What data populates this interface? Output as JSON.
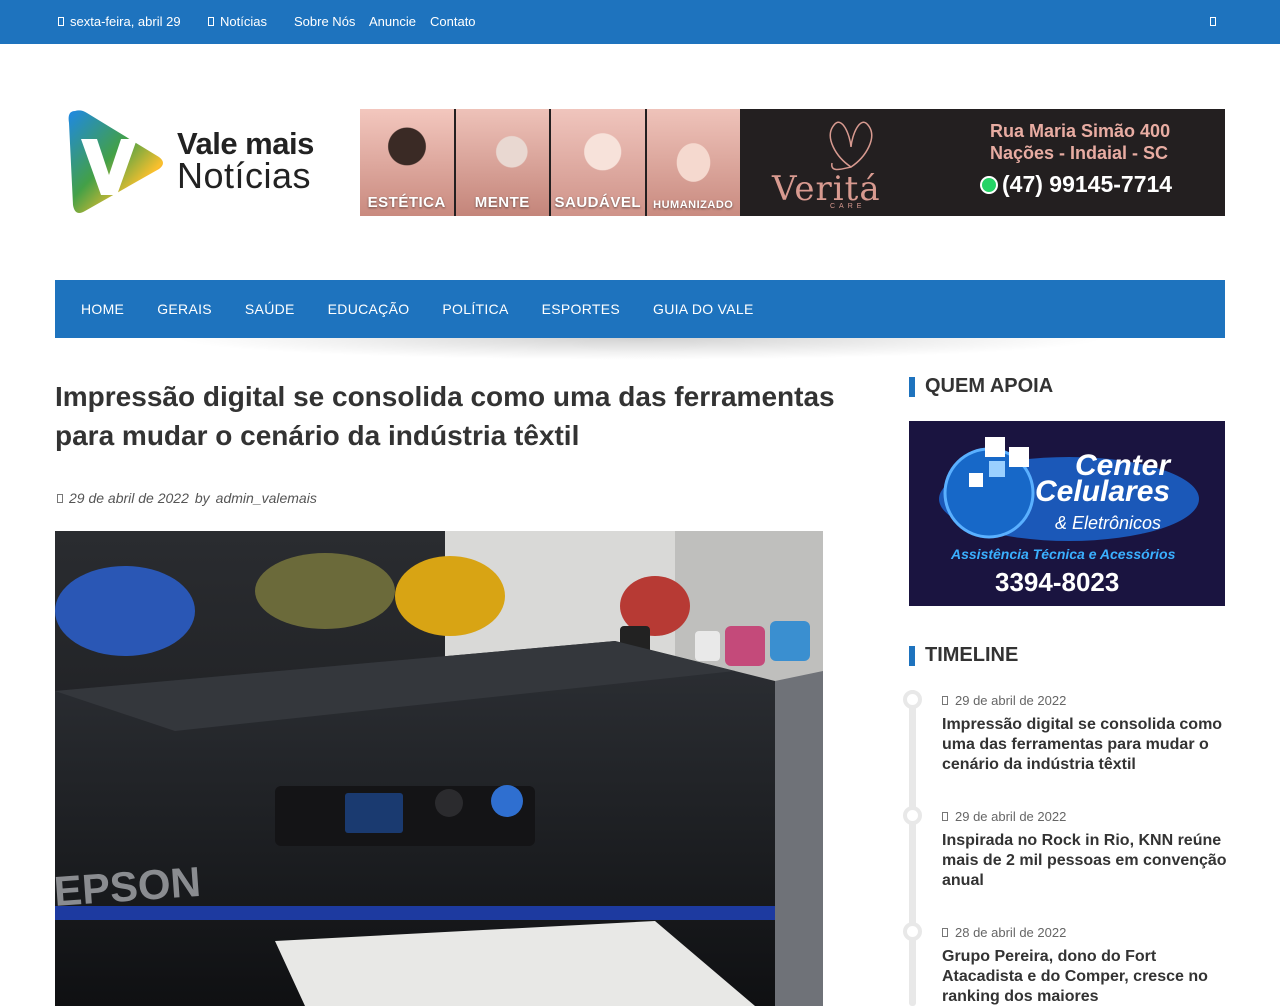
{
  "topbar": {
    "date": "sexta-feira, abril 29",
    "links": [
      "Notícias",
      "Sobre Nós",
      "Anuncie",
      "Contato"
    ],
    "search_icon": "search-icon"
  },
  "logo": {
    "line1": "Vale mais",
    "line2": "Notícias"
  },
  "banner": {
    "tags": [
      "ESTÉTICA",
      "MENTE",
      "SAUDÁVEL",
      "HUMANIZADO"
    ],
    "brand": "Veritá",
    "brand_sub": "CARE",
    "address_line1": "Rua Maria Simão 400",
    "address_line2": "Nações - Indaial - SC",
    "phone": "(47) 99145-7714"
  },
  "nav": {
    "items": [
      "HOME",
      "GERAIS",
      "SAÚDE",
      "EDUCAÇÃO",
      "POLÍTICA",
      "ESPORTES",
      "GUIA DO VALE"
    ]
  },
  "article": {
    "title": "Impressão digital se consolida como uma das ferramentas para mudar o cenário da indústria têxtil",
    "date": "29 de abril de 2022",
    "author_prefix": "by",
    "author": "admin_valemais",
    "photo_text": "EPSON"
  },
  "sidebar": {
    "support_title": "QUEM APOIA",
    "ad": {
      "line1": "Center",
      "line2": "Celulares",
      "line3": "& Eletrônicos",
      "line4": "Assistência Técnica e Acessórios",
      "phone": "3394-8023"
    },
    "timeline_title": "TIMELINE",
    "timeline": [
      {
        "date": "29 de abril de 2022",
        "title": "Impressão digital se consolida como uma das ferramentas para mudar o cenário da indústria têxtil"
      },
      {
        "date": "29 de abril de 2022",
        "title": "Inspirada no Rock in Rio, KNN reúne mais de 2 mil pessoas em convenção anual"
      },
      {
        "date": "28 de abril de 2022",
        "title": "Grupo Pereira, dono do Fort Atacadista e do Comper, cresce no ranking dos maiores"
      }
    ]
  },
  "colors": {
    "accent": "#1e73be"
  }
}
